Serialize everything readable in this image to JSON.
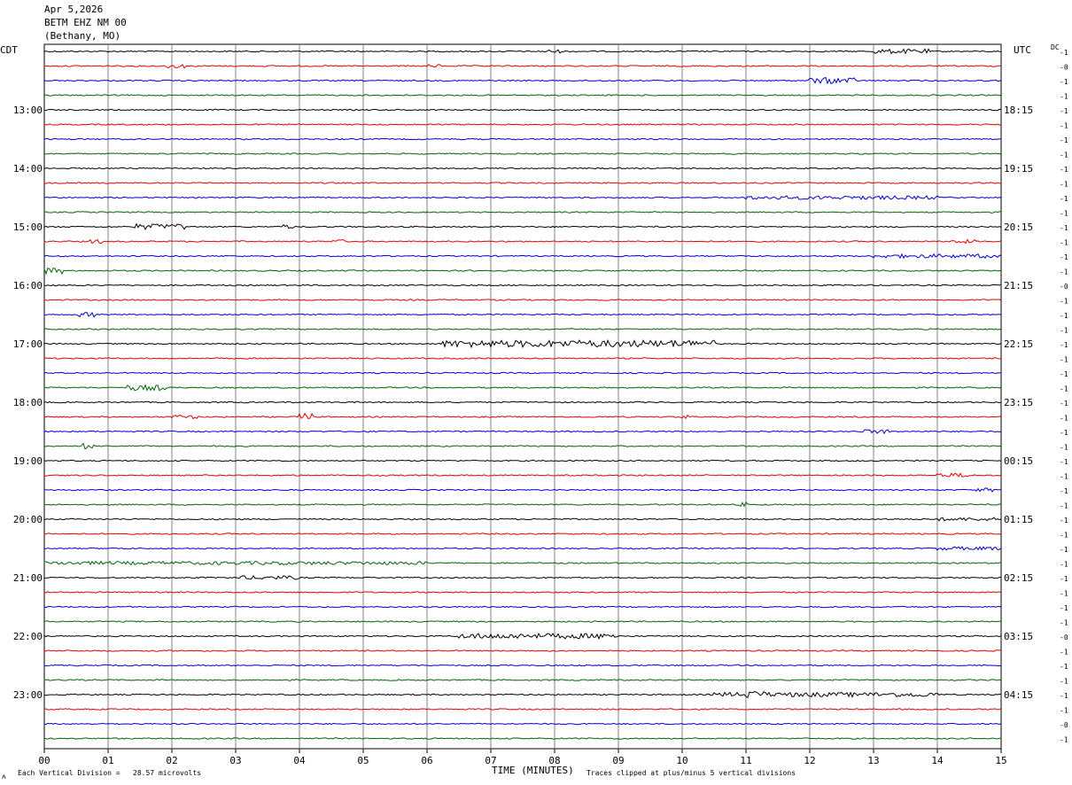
{
  "header": {
    "date": "Apr 5,2026",
    "station": "BETM EHZ NM 00",
    "location": "(Bethany, MO)"
  },
  "left_zone_label": "CDT",
  "right_zone_label": "UTC",
  "dc_label": "DC",
  "footer": {
    "scale_note": "Each Vertical Division =   28.57 microvolts",
    "clip_note": "Traces clipped at plus/minus 5 vertical divisions",
    "corner_mark": "ʌ"
  },
  "chart_data": {
    "type": "line",
    "title": "",
    "xlabel": "TIME (MINUTES)",
    "ylabel": "",
    "xlim": [
      0,
      15
    ],
    "x_ticks": [
      "00",
      "01",
      "02",
      "03",
      "04",
      "05",
      "06",
      "07",
      "08",
      "09",
      "10",
      "11",
      "12",
      "13",
      "14",
      "15"
    ],
    "trace_interval_minutes": 15,
    "trace_count": 48,
    "colors": [
      "#000000",
      "#e00000",
      "#0000c8",
      "#006400"
    ],
    "left_hour_labels": [
      "13:00",
      "14:00",
      "15:00",
      "16:00",
      "17:00",
      "18:00",
      "19:00",
      "20:00",
      "21:00",
      "22:00",
      "23:00"
    ],
    "right_hour_labels": [
      "18:15",
      "19:15",
      "20:15",
      "21:15",
      "22:15",
      "23:15",
      "00:15",
      "01:15",
      "02:15",
      "03:15",
      "04:15"
    ],
    "hour_label_first_trace": 4,
    "dc_offsets": [
      "-1",
      "-0",
      "-1",
      "-1",
      "-1",
      "-1",
      "-1",
      "-1",
      "-1",
      "-1",
      "-1",
      "-1",
      "-1",
      "-1",
      "-1",
      "-1",
      "-0",
      "-1",
      "-1",
      "-1",
      "-1",
      "-1",
      "-1",
      "-1",
      "-1",
      "-1",
      "-1",
      "-1",
      "-1",
      "-1",
      "-1",
      "-1",
      "-1",
      "-1",
      "-1",
      "-1",
      "-1",
      "-1",
      "-1",
      "-1",
      "-0",
      "-1",
      "-1",
      "-1",
      "-1",
      "-1",
      "-0",
      "-1"
    ],
    "events": [
      {
        "trace": 0,
        "minute_start": 7.8,
        "minute_end": 8.1,
        "amplitude": 1.2
      },
      {
        "trace": 0,
        "minute_start": 13.0,
        "minute_end": 13.9,
        "amplitude": 1.6
      },
      {
        "trace": 1,
        "minute_start": 1.9,
        "minute_end": 2.2,
        "amplitude": 1.5
      },
      {
        "trace": 1,
        "minute_start": 6.0,
        "minute_end": 6.2,
        "amplitude": 1.2
      },
      {
        "trace": 2,
        "minute_start": 12.0,
        "minute_end": 12.7,
        "amplitude": 2.2
      },
      {
        "trace": 10,
        "minute_start": 11.0,
        "minute_end": 14.0,
        "amplitude": 1.3
      },
      {
        "trace": 12,
        "minute_start": 1.4,
        "minute_end": 2.2,
        "amplitude": 2.0
      },
      {
        "trace": 12,
        "minute_start": 3.7,
        "minute_end": 3.9,
        "amplitude": 1.6
      },
      {
        "trace": 13,
        "minute_start": 0.7,
        "minute_end": 0.9,
        "amplitude": 1.5
      },
      {
        "trace": 13,
        "minute_start": 4.5,
        "minute_end": 4.7,
        "amplitude": 1.3
      },
      {
        "trace": 13,
        "minute_start": 14.2,
        "minute_end": 14.6,
        "amplitude": 1.3
      },
      {
        "trace": 14,
        "minute_start": 13.0,
        "minute_end": 15.0,
        "amplitude": 1.4
      },
      {
        "trace": 15,
        "minute_start": 0.0,
        "minute_end": 0.3,
        "amplitude": 2.3
      },
      {
        "trace": 18,
        "minute_start": 0.5,
        "minute_end": 0.8,
        "amplitude": 1.6
      },
      {
        "trace": 20,
        "minute_start": 6.2,
        "minute_end": 10.5,
        "amplitude": 2.5
      },
      {
        "trace": 23,
        "minute_start": 1.3,
        "minute_end": 1.9,
        "amplitude": 2.0
      },
      {
        "trace": 25,
        "minute_start": 2.0,
        "minute_end": 2.4,
        "amplitude": 1.3
      },
      {
        "trace": 25,
        "minute_start": 4.0,
        "minute_end": 4.2,
        "amplitude": 2.6
      },
      {
        "trace": 25,
        "minute_start": 10.0,
        "minute_end": 10.1,
        "amplitude": 1.4
      },
      {
        "trace": 26,
        "minute_start": 12.8,
        "minute_end": 13.3,
        "amplitude": 1.4
      },
      {
        "trace": 27,
        "minute_start": 0.6,
        "minute_end": 0.8,
        "amplitude": 2.0
      },
      {
        "trace": 29,
        "minute_start": 14.0,
        "minute_end": 14.5,
        "amplitude": 1.5
      },
      {
        "trace": 30,
        "minute_start": 14.6,
        "minute_end": 14.9,
        "amplitude": 1.3
      },
      {
        "trace": 31,
        "minute_start": 10.9,
        "minute_end": 11.0,
        "amplitude": 1.6
      },
      {
        "trace": 32,
        "minute_start": 14.0,
        "minute_end": 15.0,
        "amplitude": 1.2
      },
      {
        "trace": 34,
        "minute_start": 14.0,
        "minute_end": 15.0,
        "amplitude": 1.2
      },
      {
        "trace": 35,
        "minute_start": 0.0,
        "minute_end": 6.0,
        "amplitude": 1.2
      },
      {
        "trace": 36,
        "minute_start": 3.0,
        "minute_end": 4.0,
        "amplitude": 1.3
      },
      {
        "trace": 40,
        "minute_start": 6.5,
        "minute_end": 9.0,
        "amplitude": 1.9
      },
      {
        "trace": 44,
        "minute_start": 10.5,
        "minute_end": 14.0,
        "amplitude": 1.6
      },
      {
        "trace": 44,
        "minute_start": 10.9,
        "minute_end": 11.3,
        "amplitude": 2.6
      }
    ]
  }
}
